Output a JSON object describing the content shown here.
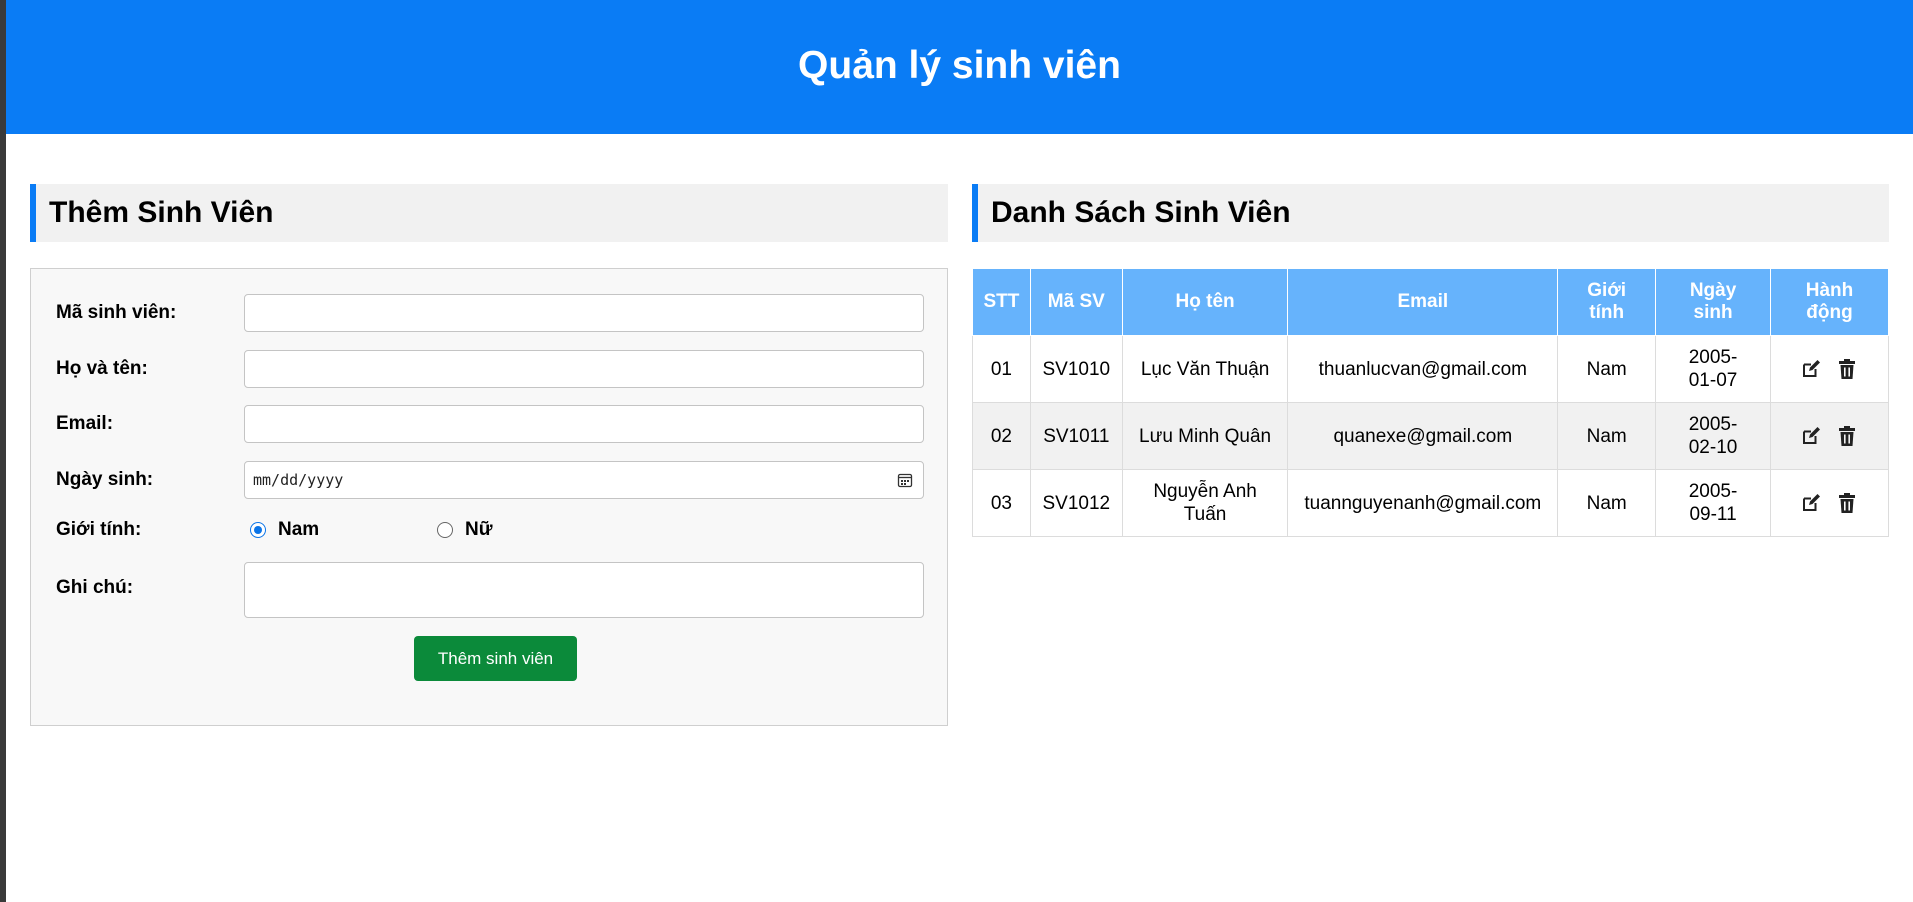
{
  "header": {
    "title": "Quản lý sinh viên"
  },
  "form_section": {
    "title": "Thêm Sinh Viên",
    "labels": {
      "student_id": "Mã sinh viên:",
      "full_name": "Họ và tên:",
      "email": "Email:",
      "dob": "Ngày sinh:",
      "gender": "Giới tính:",
      "note": "Ghi chú:"
    },
    "values": {
      "student_id": "",
      "full_name": "",
      "email": "",
      "dob": "mm/dd/yyyy",
      "note": ""
    },
    "gender_options": [
      {
        "label": "Nam",
        "checked": true
      },
      {
        "label": "Nữ",
        "checked": false
      }
    ],
    "submit_label": "Thêm sinh viên"
  },
  "list_section": {
    "title": "Danh Sách Sinh Viên",
    "columns": [
      "STT",
      "Mã SV",
      "Họ tên",
      "Email",
      "Giới tính",
      "Ngày sinh",
      "Hành động"
    ],
    "rows": [
      {
        "stt": "01",
        "id": "SV1010",
        "name": "Lục Văn Thuận",
        "email": "thuanlucvan@gmail.com",
        "gender": "Nam",
        "dob": "2005-01-07"
      },
      {
        "stt": "02",
        "id": "SV1011",
        "name": "Lưu Minh Quân",
        "email": "quanexe@gmail.com",
        "gender": "Nam",
        "dob": "2005-02-10"
      },
      {
        "stt": "03",
        "id": "SV1012",
        "name": "Nguyễn Anh Tuấn",
        "email": "tuannguyenanh@gmail.com",
        "gender": "Nam",
        "dob": "2005-09-11"
      }
    ]
  },
  "colors": {
    "primary": "#0a7cf5",
    "table_header": "#66b3fc",
    "submit": "#0b8a3a"
  },
  "icons": {
    "edit": "edit-icon",
    "delete": "trash-icon",
    "calendar": "calendar-icon"
  }
}
